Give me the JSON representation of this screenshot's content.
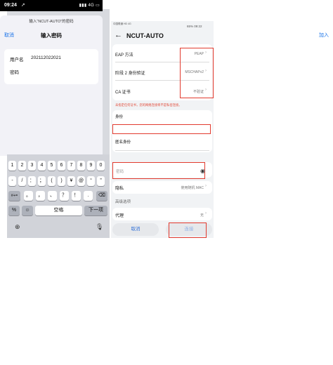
{
  "ios": {
    "status": {
      "time": "09:24",
      "right": "4G"
    },
    "sheet": {
      "hint": "输入“NCUT-AUTO”的密码",
      "cancel": "取消",
      "title": "输入密码",
      "join": "加入",
      "username_label": "用户名",
      "username_value": "202112022021",
      "password_label": "密码"
    },
    "keyboard": {
      "row1": [
        "1",
        "2",
        "3",
        "4",
        "5",
        "6",
        "7",
        "8",
        "9",
        "0"
      ],
      "row2": [
        "-",
        "/",
        "：",
        "；",
        "(",
        ")",
        "¥",
        "@",
        "“",
        "”"
      ],
      "row3": [
        "#+=",
        "。",
        "，",
        "、",
        "？",
        "！",
        "."
      ],
      "space": "空格",
      "next": "下一项"
    }
  },
  "android": {
    "status_left": "中国联通 HD 4G",
    "status_right": "65% 09:22",
    "title": "NCUT-AUTO",
    "rows": [
      {
        "label": "EAP 方法",
        "value": "PEAP"
      },
      {
        "label": "阶段 2 身份验证",
        "value": "MSCHAPv2"
      },
      {
        "label": "CA 证书",
        "value": "不验证"
      }
    ],
    "warning": "未指定任何证书，您的网络连接将不是私密连接。",
    "identity_label": "身份",
    "anon_label": "匿名身份",
    "password_placeholder": "密码",
    "privacy_label": "隐私",
    "privacy_value": "使用随机 MAC",
    "advanced_label": "高级选项",
    "proxy_label": "代理",
    "proxy_value": "无",
    "cancel_button": "取消",
    "connect_button": "连接",
    "highlight_color": "#e23a2e",
    "accent_color": "#2f6fd6"
  }
}
